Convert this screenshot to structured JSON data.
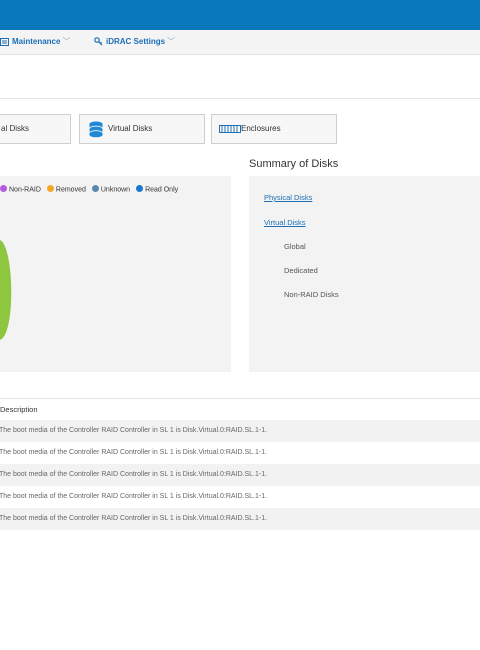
{
  "nav": {
    "maintenance_label": "Maintenance",
    "idrac_settings_label": "iDRAC Settings"
  },
  "tabs": {
    "physical_label": "al Disks",
    "virtual_label": "Virtual Disks",
    "enclosures_label": "Enclosures"
  },
  "legend": [
    {
      "label": "Non-RAID",
      "color": "#b45be0"
    },
    {
      "label": "Removed",
      "color": "#f5a623"
    },
    {
      "label": "Unknown",
      "color": "#5b87ad"
    },
    {
      "label": "Read Only",
      "color": "#1976d2"
    }
  ],
  "chart_color": "#8dc63f",
  "summary": {
    "title": "Summary of Disks",
    "physical_link": "Physical Disks",
    "virtual_link": "Virtual Disks",
    "global_label": "Global",
    "dedicated_label": "Dedicated",
    "nonraid_label": "Non-RAID Disks"
  },
  "table": {
    "header": "Description",
    "rows": [
      "The boot media of the Controller RAID Controller in SL 1 is Disk.Virtual.0:RAID.SL.1-1.",
      "The boot media of the Controller RAID Controller in SL 1 is Disk.Virtual.0:RAID.SL.1-1.",
      "The boot media of the Controller RAID Controller in SL 1 is Disk.Virtual.0:RAID.SL.1-1.",
      "The boot media of the Controller RAID Controller in SL 1 is Disk.Virtual.0:RAID.SL.1-1.",
      "The boot media of the Controller RAID Controller in SL 1 is Disk.Virtual.0:RAID.SL.1-1."
    ]
  }
}
